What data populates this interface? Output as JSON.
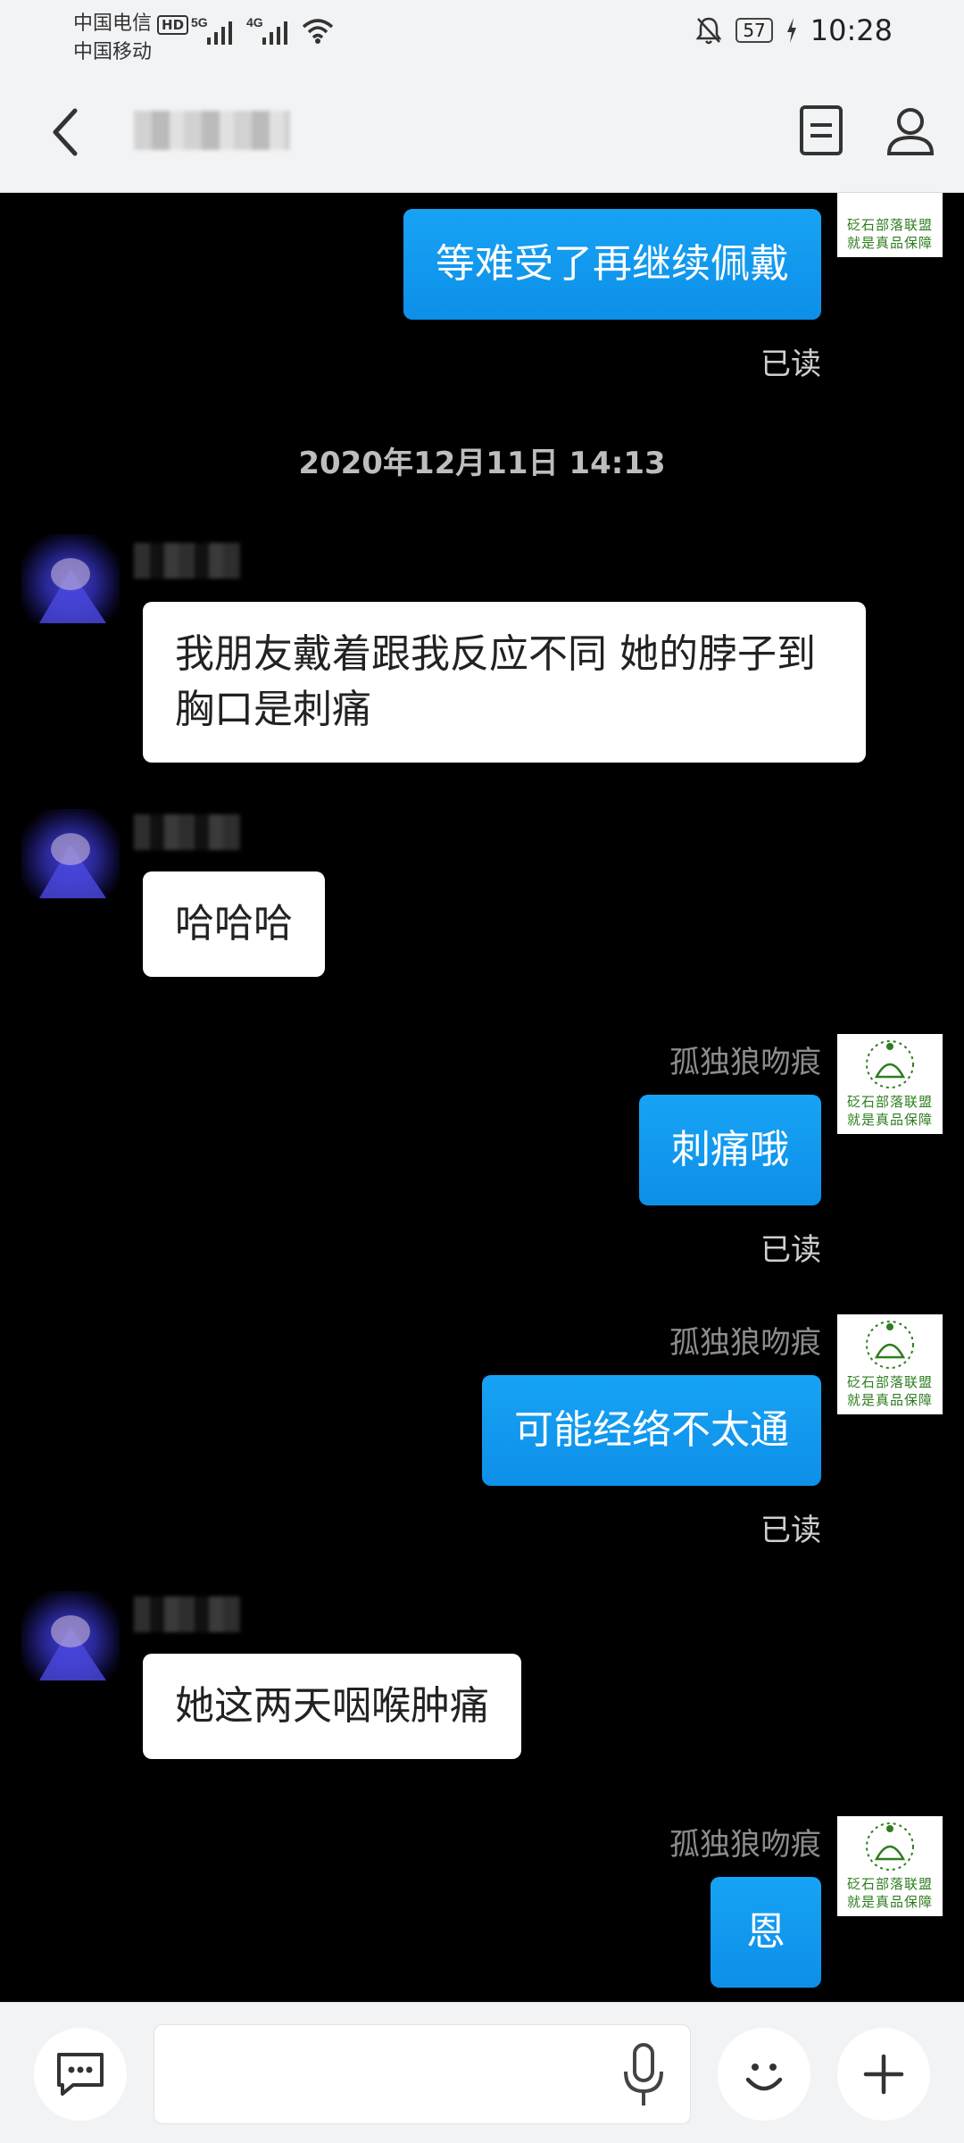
{
  "status_bar": {
    "carrier_1": "中国电信",
    "hd": "HD",
    "net_1": "5G",
    "net_2": "4G",
    "carrier_2": "中国移动",
    "battery": "57",
    "time": "10:28"
  },
  "header": {
    "title": ""
  },
  "chat": {
    "timestamp": "2020年12月11日 14:13",
    "read_label": "已读",
    "self_name": "孤独狼吻痕",
    "avatar_logo_line1": "砭石部落联盟",
    "avatar_logo_line2": "就是真品保障",
    "messages": [
      {
        "direction": "out",
        "text": "等难受了再继续佩戴"
      },
      {
        "direction": "in",
        "text": "我朋友戴着跟我反应不同 她的脖子到胸口是刺痛"
      },
      {
        "direction": "in",
        "text": "哈哈哈"
      },
      {
        "direction": "out",
        "text": "刺痛哦"
      },
      {
        "direction": "out",
        "text": "可能经络不太通"
      },
      {
        "direction": "in",
        "text": "她这两天咽喉肿痛"
      },
      {
        "direction": "out",
        "text": "恩"
      }
    ]
  },
  "input_bar": {
    "placeholder": ""
  },
  "colors": {
    "outgoing_bubble": "#17a3f5",
    "incoming_bubble": "#ffffff",
    "chat_background": "#000000",
    "logo_green": "#2e7d1f"
  }
}
